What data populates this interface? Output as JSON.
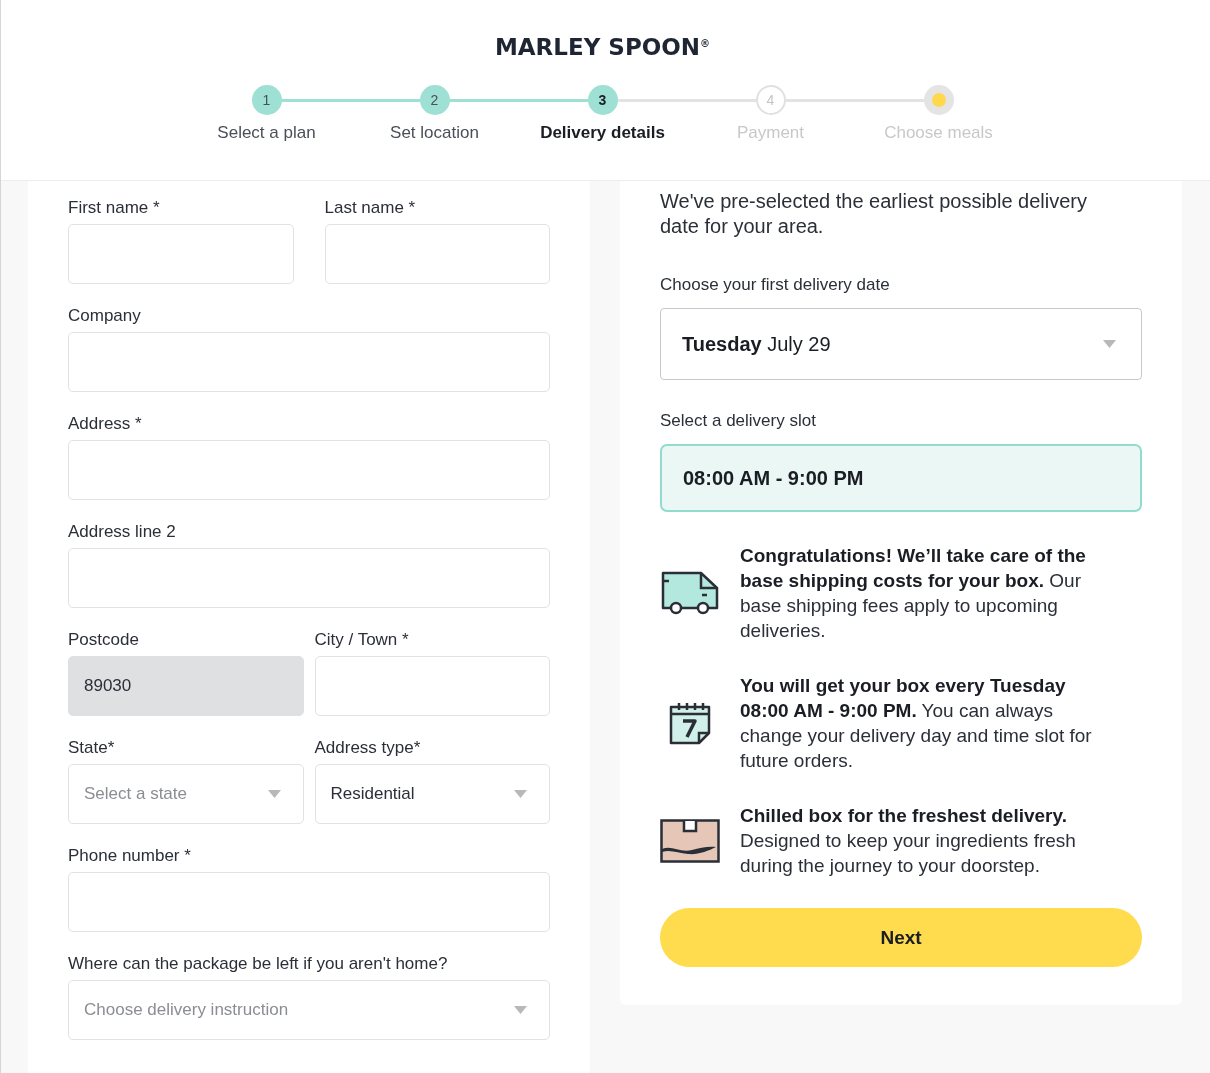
{
  "logo": "MARLEY SPOON$^{®}$",
  "steps": [
    {
      "kind": "number",
      "number": "1",
      "label": "Select a plan",
      "completed": true,
      "selected": false
    },
    {
      "kind": "number",
      "number": "2",
      "label": "Set location",
      "completed": true,
      "selected": false
    },
    {
      "kind": "number",
      "number": "3",
      "label": "Delivery details",
      "completed": false,
      "selected": true
    },
    {
      "kind": "number",
      "number": "4",
      "label": "Payment",
      "completed": false,
      "selected": false
    },
    {
      "kind": "dot",
      "label": "Choose meals",
      "completed": false,
      "selected": false
    }
  ],
  "form": {
    "rows": [
      {
        "fields": [
          {
            "kind": "text",
            "label": "First name *",
            "disabled": false
          },
          {
            "kind": "text",
            "label": "Last name *",
            "disabled": false
          }
        ]
      },
      {
        "fields": [
          {
            "kind": "text",
            "label": "Company",
            "disabled": false
          }
        ]
      },
      {
        "fields": [
          {
            "kind": "text",
            "label": "Address *",
            "disabled": false
          }
        ]
      },
      {
        "fields": [
          {
            "kind": "text",
            "label": "Address line 2",
            "disabled": false
          }
        ]
      },
      {
        "fields": [
          {
            "kind": "text",
            "label": "Postcode",
            "value": "89030",
            "disabled": true
          },
          {
            "kind": "text",
            "label": "City / Town *",
            "disabled": false
          }
        ]
      },
      {
        "fields": [
          {
            "kind": "select",
            "label": "State*",
            "placeholder": "Select a state",
            "disabled": false
          },
          {
            "kind": "select",
            "label": "Address type*",
            "value": "Residential",
            "disabled": false
          }
        ]
      },
      {
        "fields": [
          {
            "kind": "text",
            "label": "Phone number *",
            "disabled": false
          }
        ]
      },
      {
        "fields": [
          {
            "kind": "select",
            "label": "Where can the package be left if you aren't home?",
            "placeholder": "Choose delivery instruction",
            "disabled": false
          }
        ]
      }
    ]
  },
  "delivery": {
    "intro": "We've pre-selected the earliest possible delivery date for your area.",
    "date_label": "Choose your first delivery date",
    "date_select": {
      "value": "**Tuesday** July 29"
    },
    "slot_label": "Select a delivery slot",
    "slots": [
      {
        "label": "08:00 AM - 9:00 PM",
        "selected": true
      }
    ],
    "info": [
      {
        "kind": "truck",
        "text": "**Congratulations! We’ll take care of the base shipping costs for your box.** Our base shipping fees apply to upcoming deliveries."
      },
      {
        "kind": "calendar",
        "text": "**You will get your box every Tuesday 08:00 AM - 9:00 PM.** You can always change your delivery day and time slot for future orders."
      },
      {
        "kind": "box",
        "text": "**Chilled box for the freshest delivery.** Designed to keep your ingredients fresh during the journey to your doorstep."
      }
    ],
    "next_button": "Next"
  }
}
